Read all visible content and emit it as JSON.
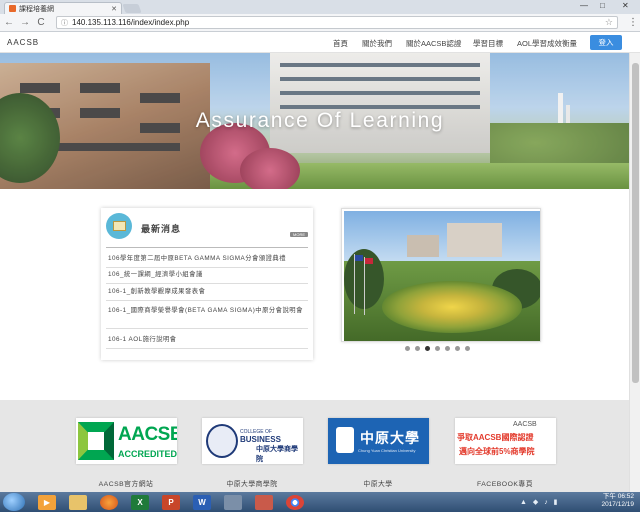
{
  "browser": {
    "tab_title": "課程培養網",
    "tab_close": "✕",
    "url": "140.135.113.116/index/index.php",
    "back": "←",
    "forward": "→",
    "reload": "C",
    "minimize": "—",
    "maximize": "□",
    "close": "✕",
    "star": "☆",
    "menu": "⋮"
  },
  "header": {
    "brand": "AACSB",
    "nav": [
      "首頁",
      "關於我們",
      "關於AACSB認證",
      "學習目標",
      "AOL學習成效衡量"
    ],
    "login": "登入"
  },
  "hero": {
    "title": "Assurance Of Learning"
  },
  "news": {
    "title": "最新消息",
    "more": "MORE",
    "items": [
      "106學年度第二屆中原BETA GAMMA SIGMA分會頒證典禮",
      "106_統一課綱_經濟學小組會議",
      "106-1_創新教學觀摩成果發表會",
      "106-1_國際商學榮譽學會(BETA GAMA SIGMA)中原分會說明會",
      "106-1 AOL施行說明會"
    ]
  },
  "slider": {
    "dots": 7,
    "active": 2
  },
  "footer": {
    "logos": [
      {
        "caption": "AACSB官方網站",
        "icon": "aacsb-logo",
        "line1": "AACSB",
        "line2": "ACCREDITED"
      },
      {
        "caption": "中原大學商學院",
        "icon": "cycu-business-logo",
        "line1": "COLLEGE OF",
        "line2": "BUSINESS",
        "line3": "中原大學商學院"
      },
      {
        "caption": "中原大學",
        "icon": "cycu-logo",
        "line1": "中原大學",
        "line2": "Chung Yuan Christian University"
      },
      {
        "caption": "FACEBOOK專頁",
        "icon": "facebook-banner",
        "line1": "爭取AACSB國際認證",
        "line2": "邁向全球前5%商學院",
        "line3": "AACSB"
      }
    ]
  },
  "taskbar": {
    "time": "下午 06:52",
    "date": "2017/12/19",
    "apps": [
      "media-player",
      "file-explorer",
      "firefox",
      "excel",
      "powerpoint",
      "word",
      "network-tool",
      "snipping-tool",
      "chrome"
    ]
  },
  "colors": {
    "login_button": "#3a8de0",
    "aacsb_green": "#00a651",
    "cycu_blue": "#1d64b4"
  }
}
